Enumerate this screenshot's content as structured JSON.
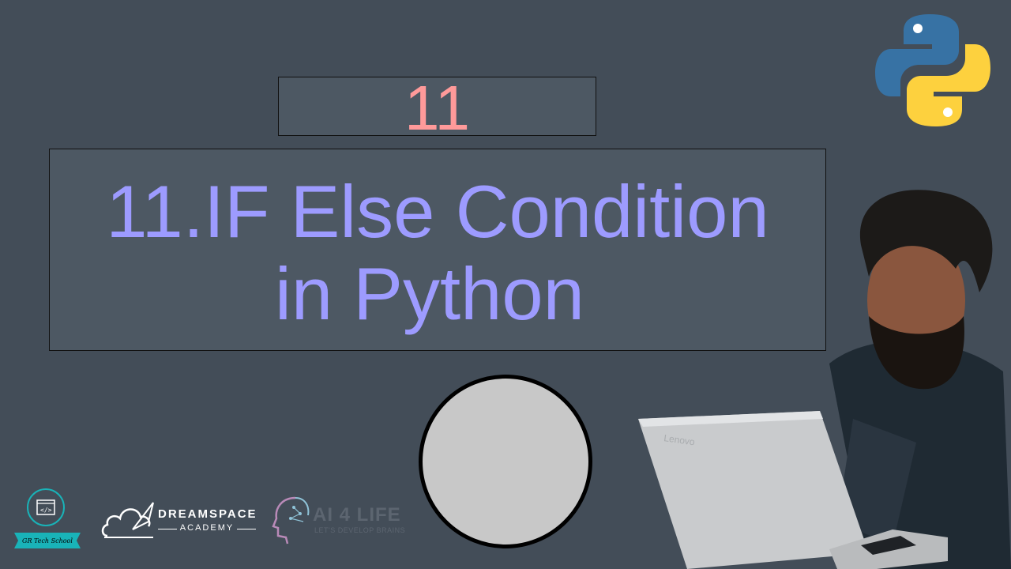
{
  "lesson_number": "11",
  "title": {
    "line1": "11.IF Else Condition",
    "line2": "in Python"
  },
  "logos": {
    "python": "python-logo-icon",
    "gr_tech_school": "GR Tech School",
    "dreamspace": {
      "name": "DREAMSPACE",
      "sub": "ACADEMY"
    },
    "ai4life": {
      "name": "AI 4 LIFE",
      "tagline": "LET'S DEVELOP BRAINS"
    }
  },
  "laptop_brand": "Lenovo",
  "colors": {
    "background": "#434d58",
    "number": "#ff9a9a",
    "title": "#9d9bff",
    "teal": "#19b3b8"
  }
}
